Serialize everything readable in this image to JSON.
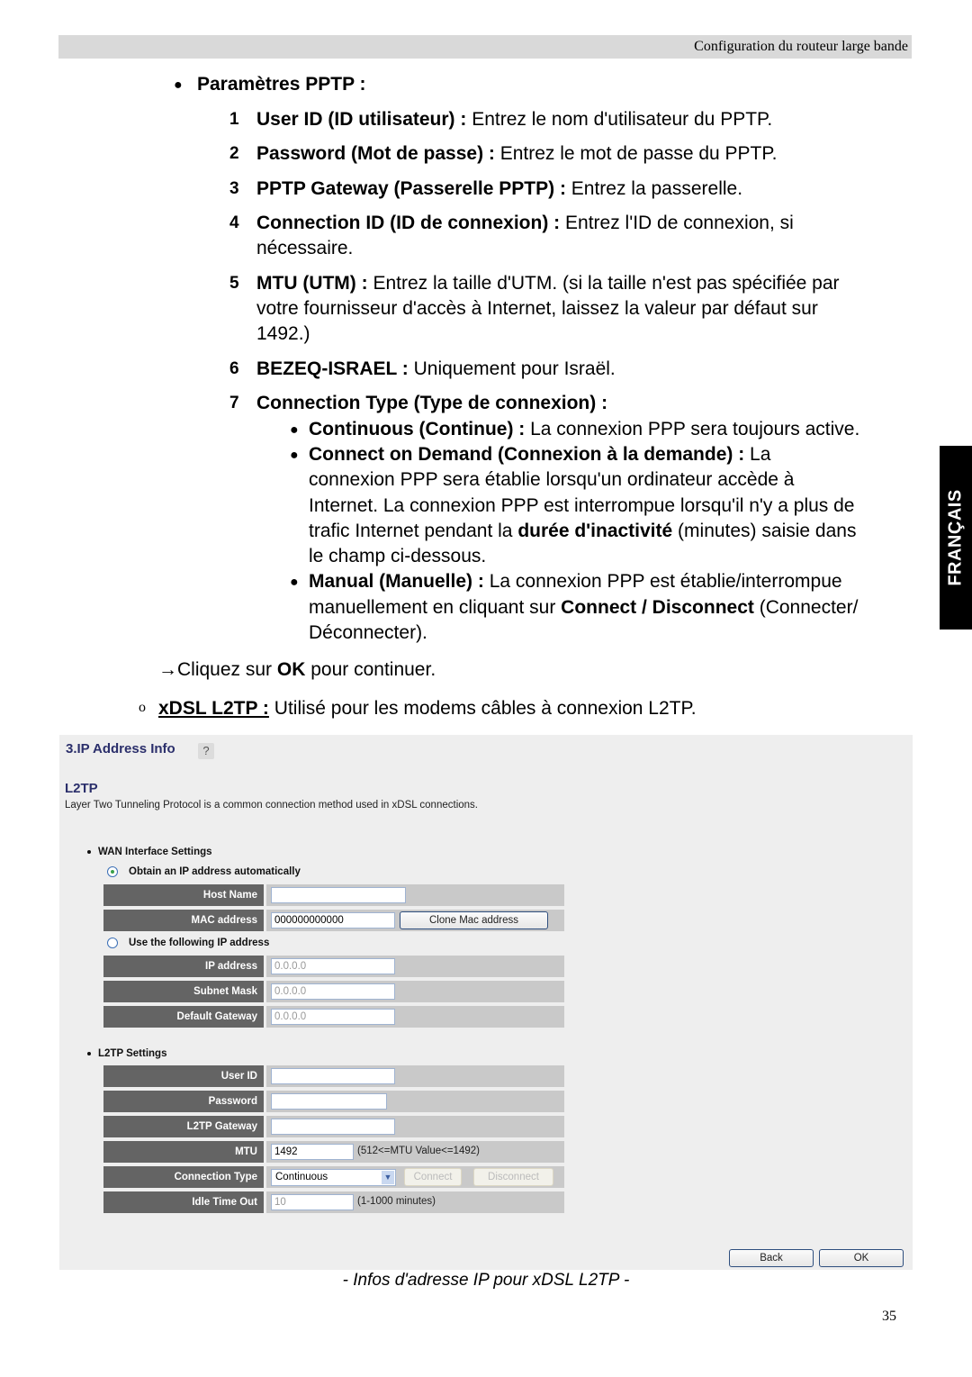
{
  "header": {
    "title": "Configuration du routeur large bande"
  },
  "side_tab": {
    "label": "FRANÇAIS"
  },
  "pptp": {
    "heading": "Paramètres PPTP :",
    "items": [
      {
        "num": "1",
        "bold": "User ID (ID utilisateur) :",
        "text": " Entrez le nom d'utilisateur du PPTP."
      },
      {
        "num": "2",
        "bold": "Password (Mot de passe) :",
        "text": " Entrez le mot de passe du PPTP."
      },
      {
        "num": "3",
        "bold": "PPTP Gateway (Passerelle PPTP) :",
        "text": " Entrez la passerelle."
      },
      {
        "num": "4",
        "bold": "Connection ID (ID de connexion) :",
        "text": " Entrez l'ID de connexion, si",
        "text2": "nécessaire."
      },
      {
        "num": "5",
        "bold": "MTU (UTM) :",
        "text": " Entrez la taille d'UTM. (si la taille n'est pas spécifiée par",
        "text2": "votre fournisseur d'accès à Internet, laissez la valeur par défaut sur",
        "text3": "1492.)"
      },
      {
        "num": "6",
        "bold": "BEZEQ-ISRAEL :",
        "text": " Uniquement pour Israël."
      },
      {
        "num": "7",
        "bold": "Connection Type (Type de connexion) :"
      }
    ],
    "conn_types": {
      "continuous_bold": "Continuous (Continue) :",
      "continuous_text": " La connexion PPP sera toujours active.",
      "demand_bold": "Connect on Demand (Connexion à la demande) :",
      "demand_text": " La",
      "demand_l2": "connexion PPP sera établie lorsqu'un ordinateur accède à",
      "demand_l3": "Internet. La connexion PPP est interrompue lorsqu'il n'y a plus de",
      "demand_l4a": "trafic Internet pendant la ",
      "demand_l4b": "durée d'inactivité",
      "demand_l4c": " (minutes) saisie dans",
      "demand_l5": "le champ ci-dessous.",
      "manual_bold": "Manual (Manuelle) :",
      "manual_text": " La connexion PPP est établie/interrompue",
      "manual_l2a": "manuellement en cliquant sur ",
      "manual_l2b": "Connect / Disconnect",
      "manual_l2c": " (Connecter/",
      "manual_l3": "Déconnecter)."
    },
    "continue_a": "→Cliquez sur ",
    "continue_b": "OK",
    "continue_c": " pour continuer."
  },
  "l2tp_intro": {
    "marker": "o",
    "bold": "xDSL L2TP :",
    "text": " Utilisé pour les modems câbles à connexion L2TP."
  },
  "panel": {
    "title": "3.IP Address Info",
    "help_icon": "?",
    "subtitle": "L2TP",
    "description": "Layer Two Tunneling Protocol is a common connection method used in xDSL connections.",
    "wan_section": "WAN Interface Settings",
    "radio_auto": "Obtain an IP address automatically",
    "radio_manual": "Use the following IP address",
    "host_name_label": "Host Name",
    "host_name_value": "",
    "mac_label": "MAC address",
    "mac_value": "000000000000",
    "clone_mac_button": "Clone Mac address",
    "ip_label": "IP address",
    "ip_value": "0.0.0.0",
    "subnet_label": "Subnet Mask",
    "subnet_value": "0.0.0.0",
    "gateway_label": "Default Gateway",
    "gateway_value": "0.0.0.0",
    "l2tp_section": "L2TP Settings",
    "user_id_label": "User ID",
    "user_id_value": "",
    "password_label": "Password",
    "password_value": "",
    "l2tp_gateway_label": "L2TP Gateway",
    "l2tp_gateway_value": "",
    "mtu_label": "MTU",
    "mtu_value": "1492",
    "mtu_note": "(512<=MTU Value<=1492)",
    "conn_type_label": "Connection Type",
    "conn_type_value": "Continuous",
    "connect_button": "Connect",
    "disconnect_button": "Disconnect",
    "idle_label": "Idle Time Out",
    "idle_value": "10",
    "idle_note": "(1-1000 minutes)",
    "back_button": "Back",
    "ok_button": "OK"
  },
  "caption": "- Infos d'adresse IP pour xDSL L2TP -",
  "page_number": "35"
}
